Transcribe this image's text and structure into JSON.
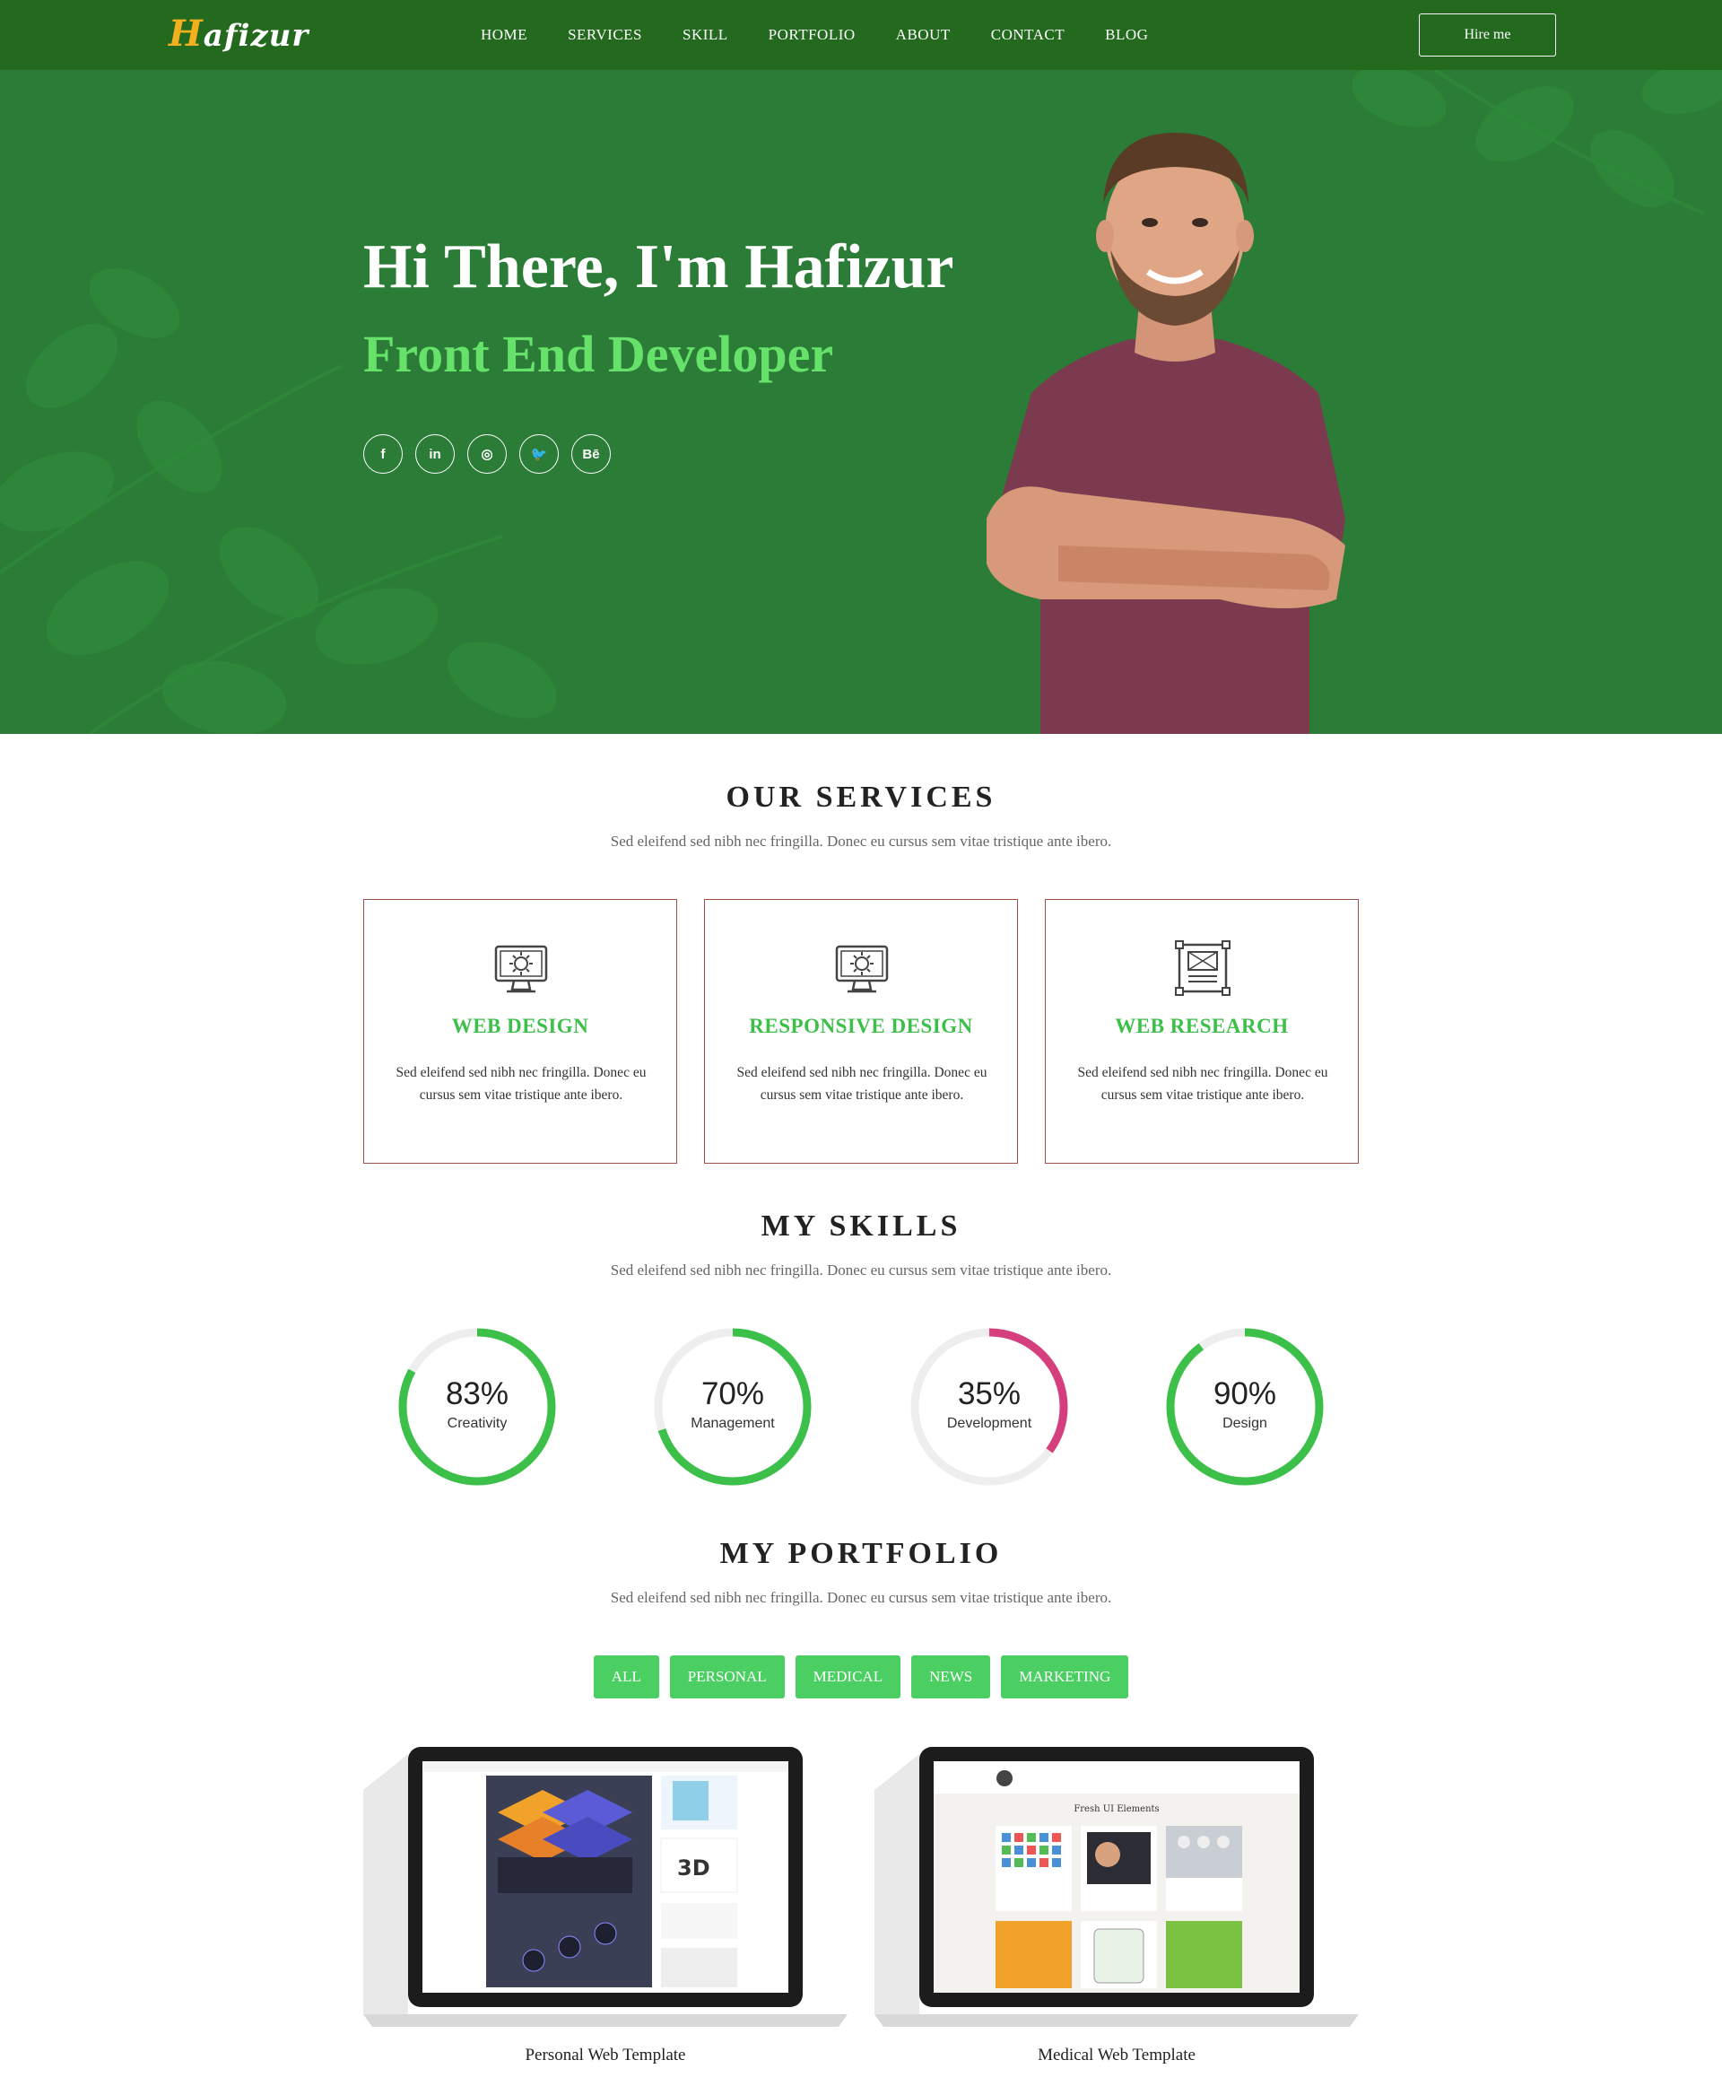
{
  "nav": {
    "logo_initial": "H",
    "logo_rest": "afizur",
    "links": [
      "HOME",
      "SERVICES",
      "SKILL",
      "PORTFOLIO",
      "ABOUT",
      "CONTACT",
      "BLOG"
    ],
    "hire_label": "Hire me"
  },
  "hero": {
    "title": "Hi There, I'm Hafizur",
    "subtitle": "Front End Developer",
    "social": [
      {
        "icon": "facebook-icon",
        "glyph": "f"
      },
      {
        "icon": "linkedin-icon",
        "glyph": "in"
      },
      {
        "icon": "instagram-icon",
        "glyph": "◎"
      },
      {
        "icon": "twitter-icon",
        "glyph": "🐦"
      },
      {
        "icon": "behance-icon",
        "glyph": "Bē"
      }
    ]
  },
  "services": {
    "title": "OUR SERVICES",
    "subtitle": "Sed eleifend sed nibh nec fringilla. Donec eu cursus sem vitae tristique ante ibero.",
    "cards": [
      {
        "icon": "monitor-gear-icon",
        "title": "WEB DESIGN",
        "desc": "Sed eleifend sed nibh nec fringilla. Donec eu cursus sem vitae tristique ante ibero."
      },
      {
        "icon": "monitor-gear-icon",
        "title": "RESPONSIVE DESIGN",
        "desc": "Sed eleifend sed nibh nec fringilla. Donec eu cursus sem vitae tristique ante ibero."
      },
      {
        "icon": "wireframe-icon",
        "title": "WEB RESEARCH",
        "desc": "Sed eleifend sed nibh nec fringilla. Donec eu cursus sem vitae tristique ante ibero."
      }
    ]
  },
  "skills": {
    "title": "MY SKILLS",
    "subtitle": "Sed eleifend sed nibh nec fringilla. Donec eu cursus sem vitae tristique ante ibero.",
    "items": [
      {
        "percent": "83%",
        "value": 83,
        "label": "Creativity",
        "color": "#3cc04a"
      },
      {
        "percent": "70%",
        "value": 70,
        "label": "Management",
        "color": "#3cc04a"
      },
      {
        "percent": "35%",
        "value": 35,
        "label": "Development",
        "color": "#d63f7e"
      },
      {
        "percent": "90%",
        "value": 90,
        "label": "Design",
        "color": "#3cc04a"
      }
    ]
  },
  "portfolio": {
    "title": "MY PORTFOLIO",
    "subtitle": "Sed eleifend sed nibh nec fringilla. Donec eu cursus sem vitae tristique ante ibero.",
    "filters": [
      "ALL",
      "PERSONAL",
      "MEDICAL",
      "NEWS",
      "MARKETING"
    ],
    "items": [
      {
        "caption": "Personal Web Template"
      },
      {
        "caption": "Medical Web Template",
        "screen_heading": "Fresh UI Elements"
      }
    ]
  },
  "colors": {
    "nav_bg": "#236a1f",
    "hero_bg": "#2a7c36",
    "accent_green": "#3cc04a",
    "subtitle_green": "#66e26b",
    "filter_green": "#4ccf62",
    "logo_yellow": "#f2b01e",
    "card_border": "#a0504a",
    "pink": "#d63f7e"
  }
}
